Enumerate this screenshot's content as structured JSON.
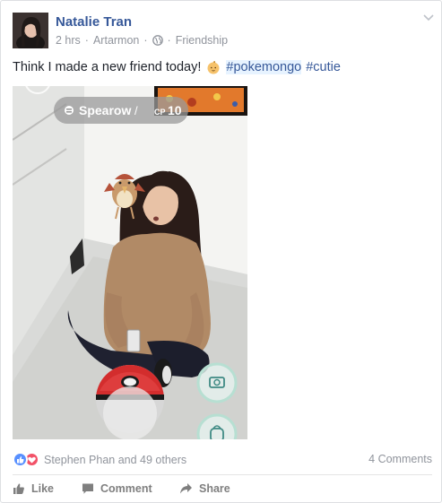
{
  "post": {
    "author": "Natalie Tran",
    "time": "2 hrs",
    "location": "Artarmon",
    "audience": "Friendship",
    "status_text": "Think I made a new friend today!",
    "hashtags": [
      "#pokemongo",
      "#cutie"
    ]
  },
  "photo": {
    "pokemon_name": "Spearow",
    "cp_label": "CP",
    "cp_value": "10"
  },
  "reactions": {
    "summary": "Stephen Phan and 49 others",
    "comments": "4 Comments"
  },
  "actions": {
    "like": "Like",
    "comment": "Comment",
    "share": "Share"
  },
  "icons": {
    "like": "thumbs-up-icon",
    "comment": "speech-bubble-icon",
    "share": "share-arrow-icon",
    "audience": "globe-icon",
    "menu": "chevron-down-icon"
  },
  "colors": {
    "link": "#365899",
    "meta": "#90949c",
    "like_reaction": "#5890ff",
    "love_reaction": "#f25268"
  }
}
